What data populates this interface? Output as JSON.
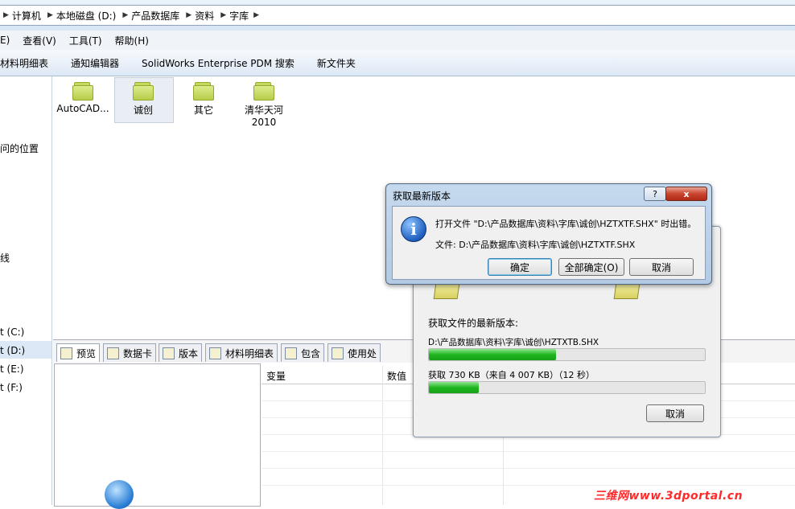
{
  "address_bar": {
    "crumbs": [
      "计算机",
      "本地磁盘 (D:)",
      "产品数据库",
      "资料",
      "字库"
    ]
  },
  "menu": {
    "items": [
      "E)",
      "查看(V)",
      "工具(T)",
      "帮助(H)"
    ]
  },
  "toolbar": {
    "items": [
      "材料明细表",
      "通知编辑器",
      "SolidWorks Enterprise PDM 搜索",
      "新文件夹"
    ]
  },
  "nav": {
    "items": [
      "问的位置",
      "线",
      "t (C:)",
      "t (D:)",
      "t (E:)",
      "t (F:)"
    ],
    "selected_index": 3
  },
  "folders": [
    {
      "label": "AutoCAD...",
      "selected": false
    },
    {
      "label": "诚创",
      "selected": true
    },
    {
      "label": "其它",
      "selected": false
    },
    {
      "label": "清华天河",
      "label2": "2010",
      "selected": false
    }
  ],
  "tabs": [
    "预览",
    "数据卡",
    "版本",
    "材料明细表",
    "包含",
    "使用处"
  ],
  "table": {
    "headers": [
      "变量",
      "数值"
    ]
  },
  "progress_dialog": {
    "label": "获取文件的最新版本:",
    "file_path": "D:\\产品数据库\\资料\\字库\\诚创\\HZTXTB.SHX",
    "file_progress": 0.46,
    "transfer_text": "获取 730 KB（来自 4 007 KB）（12 秒）",
    "overall_progress": 0.18,
    "cancel_label": "取消"
  },
  "error_dialog": {
    "title": "获取最新版本",
    "help": "?",
    "close": "x",
    "message": "打开文件 \"D:\\产品数据库\\资料\\字库\\诚创\\HZTXTF.SHX\" 时出错。",
    "file_line": "文件: D:\\产品数据库\\资料\\字库\\诚创\\HZTXTF.SHX",
    "buttons": {
      "ok": "确定",
      "ok_all": "全部确定(O)",
      "cancel": "取消"
    }
  },
  "watermark": "三维网www.3dportal.cn",
  "colors": {
    "progress_green": "#1fb51f",
    "watermark_red": "#ff2a2a",
    "close_red": "#c9452e"
  }
}
